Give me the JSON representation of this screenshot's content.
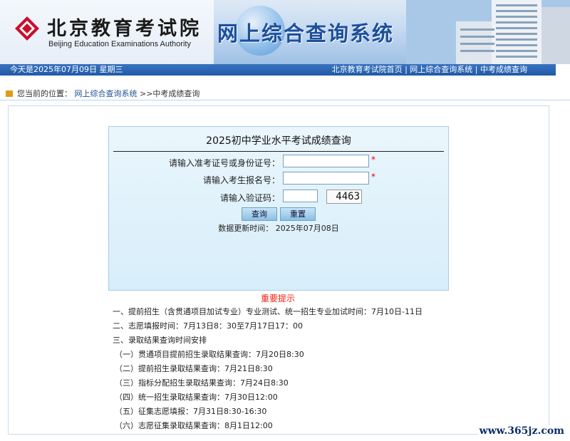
{
  "header": {
    "org_name_cn": "北京教育考试院",
    "org_name_en": "Beijing Education Examinations Authority",
    "system_title": "网上综合查询系统"
  },
  "navbar": {
    "date_text": "今天是2025年07月09日  星期三",
    "links": [
      "北京教育考试院首页",
      "网上综合查询系统",
      "中考成绩查询"
    ],
    "separator": " | "
  },
  "breadcrumb": {
    "prefix": "您当前的位置：",
    "link": "网上综合查询系统",
    "current": " >>中考成绩查询"
  },
  "form": {
    "title": "2025初中学业水平考试成绩查询",
    "id_label": "请输入准考证号或身份证号：",
    "name_label": "请输入考生报名号：",
    "captcha_label": "请输入验证码：",
    "required_mark": "*",
    "captcha_text": "4463",
    "submit_label": "查询",
    "reset_label": "重置",
    "update_text": "数据更新时间：  2025年07月08日"
  },
  "notice": {
    "title": "重要提示",
    "items": [
      "一、提前招生（含贯通项目加试专业）专业测试、统一招生专业加试时间：7月10日-11日",
      "二、志愿填报时间：7月13日8：30至7月17日17：00",
      "三、录取结果查询时间安排",
      "（一）贯通项目提前招生录取结果查询：7月20日8:30",
      "（二）提前招生录取结果查询：7月21日8:30",
      "（三）指标分配招生录取结果查询：7月24日8:30",
      "（四）统一招生录取结果查询：7月30日12:00",
      "（五）征集志愿填报：7月31日8:30-16:30",
      "（六）志愿征集录取结果查询：8月1日12:00"
    ]
  },
  "watermark": "www.365jz.com",
  "colors": {
    "nav_bg": "#1f5aa8",
    "required": "#e00000",
    "notice_title": "#e21111",
    "logo_red": "#c8102e"
  }
}
